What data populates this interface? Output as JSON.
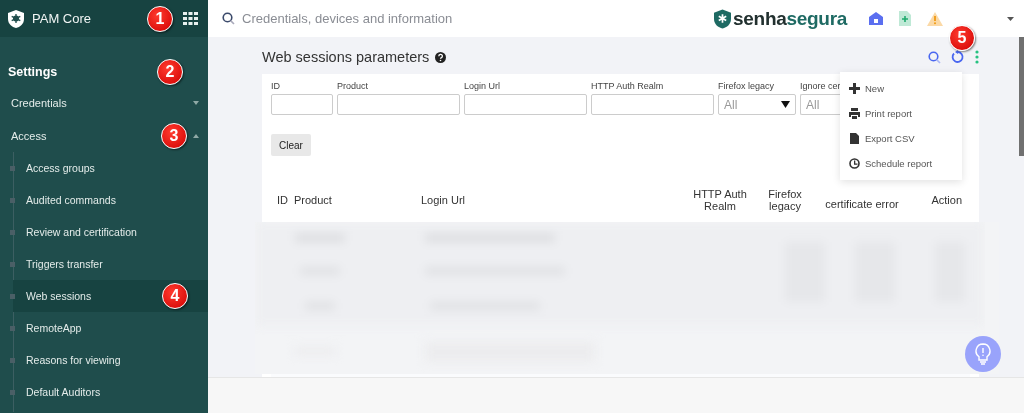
{
  "app": {
    "title": "PAM Core",
    "callout": "1"
  },
  "search": {
    "placeholder": "Credentials, devices and information"
  },
  "brand": {
    "parts": [
      "senha",
      "segura"
    ]
  },
  "sidebar": {
    "heading": "Settings",
    "callout": "2",
    "groups": [
      {
        "label": "Credentials",
        "expanded": false
      },
      {
        "label": "Access",
        "expanded": true,
        "callout": "3",
        "children": [
          {
            "label": "Access groups",
            "selected": false
          },
          {
            "label": "Audited commands",
            "selected": false
          },
          {
            "label": "Review and certification",
            "selected": false
          },
          {
            "label": "Triggers transfer",
            "selected": false
          },
          {
            "label": "Web sessions",
            "selected": true,
            "callout": "4"
          },
          {
            "label": "RemoteApp",
            "selected": false
          },
          {
            "label": "Reasons for viewing",
            "selected": false
          },
          {
            "label": "Default Auditors",
            "selected": false
          }
        ]
      }
    ]
  },
  "page": {
    "title": "Web sessions parameters",
    "callout": "5"
  },
  "filters": [
    {
      "label": "ID",
      "kind": "text"
    },
    {
      "label": "Product",
      "kind": "text"
    },
    {
      "label": "Login Url",
      "kind": "text"
    },
    {
      "label": "HTTP Auth Realm",
      "kind": "text"
    },
    {
      "label": "Firefox legacy",
      "kind": "select",
      "value": "All"
    },
    {
      "label": "Ignore cer",
      "kind": "partial_select",
      "value": "All"
    }
  ],
  "clear_button": "Clear",
  "table": {
    "columns": [
      "ID",
      "Product",
      "Login Url",
      "HTTP Auth Realm",
      "Firefox legacy",
      "certificate error",
      "Action"
    ]
  },
  "menu": {
    "items": [
      {
        "label": "New",
        "kind": "plus"
      },
      {
        "label": "Print report",
        "kind": "printer"
      },
      {
        "label": "Export CSV",
        "kind": "file"
      },
      {
        "label": "Schedule report",
        "kind": "clock"
      }
    ]
  }
}
